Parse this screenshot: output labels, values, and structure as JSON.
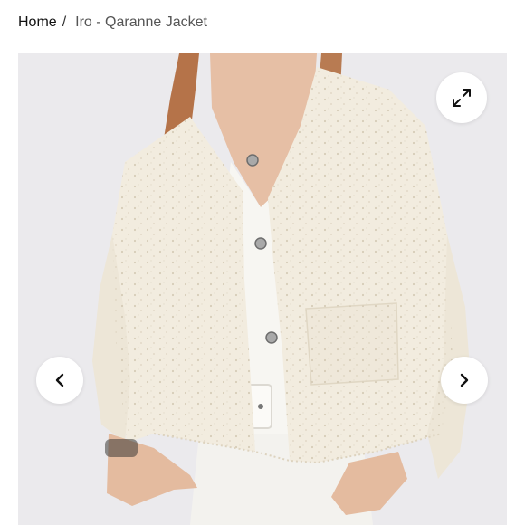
{
  "breadcrumb": {
    "home_label": "Home",
    "separator": "/",
    "current_label": "Iro - Qaranne Jacket"
  },
  "gallery": {
    "image_icon": "product-photo",
    "expand_icon": "expand-arrows-icon",
    "prev_icon": "chevron-left-icon",
    "next_icon": "chevron-right-icon"
  },
  "colors": {
    "background": "#ffffff",
    "photo_backdrop": "#ebeaed",
    "jacket": "#f2ecdf",
    "button": "#ffffff",
    "icon": "#111111"
  }
}
